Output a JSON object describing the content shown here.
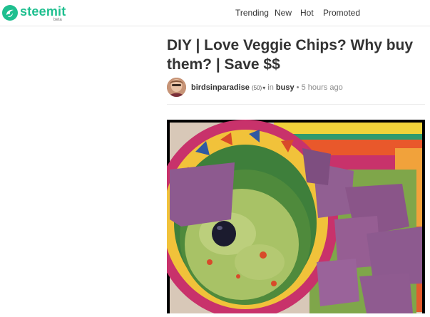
{
  "header": {
    "logo_text": "steemit",
    "logo_badge": "beta",
    "brand_color": "#1fbf8f",
    "nav": [
      {
        "label": "Trending"
      },
      {
        "label": "New"
      },
      {
        "label": "Hot"
      },
      {
        "label": "Promoted"
      }
    ]
  },
  "post": {
    "title": "DIY | Love Veggie Chips? Why buy them? | Save $$",
    "author": "birdsinparadise",
    "reputation": "(50)",
    "in_label": "in",
    "category": "busy",
    "time": "5 hours ago"
  }
}
